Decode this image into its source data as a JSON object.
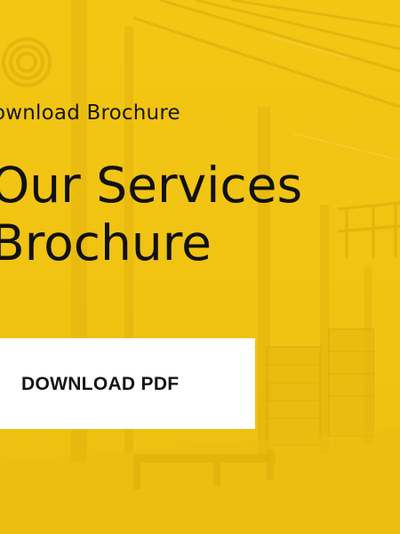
{
  "hero": {
    "eyebrow": "ownload Brochure",
    "title_line_1": "Our Services",
    "title_line_2": "Brochure",
    "background_color": "#f0c419"
  },
  "cta": {
    "button_label": "DOWNLOAD PDF",
    "button_background": "#ffffff"
  }
}
